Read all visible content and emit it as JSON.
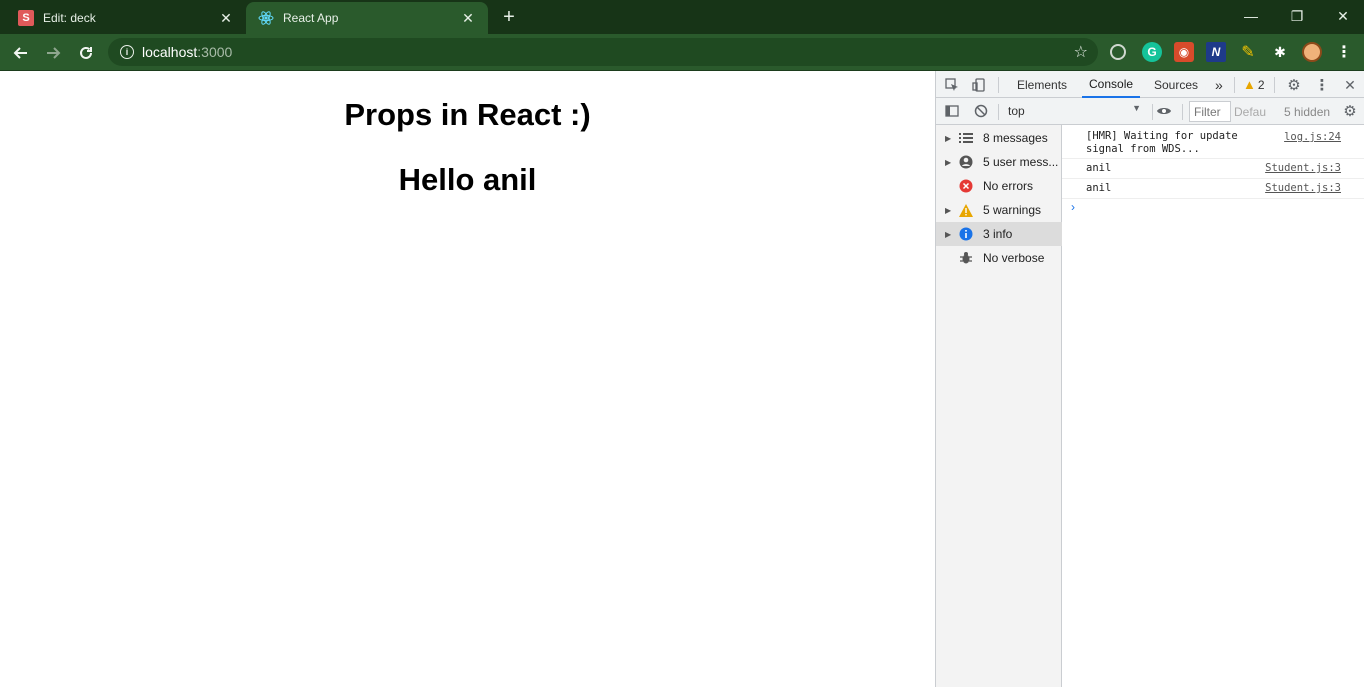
{
  "browser": {
    "tabs": [
      {
        "title": "Edit: deck",
        "favicon_letter": "S",
        "active": false
      },
      {
        "title": "React App",
        "favicon": "react-icon",
        "active": true
      }
    ],
    "new_tab_label": "+",
    "address": {
      "host": "localhost",
      "port": ":3000"
    },
    "window_controls": {
      "minimize": "—",
      "restore": "❐",
      "close": "✕"
    }
  },
  "page": {
    "heading": "Props in React :)",
    "greeting": "Hello anil"
  },
  "devtools": {
    "tabs": [
      "Elements",
      "Console",
      "Sources"
    ],
    "active_tab": "Console",
    "more_tabs": "»",
    "warning_count": "2",
    "filter_bar": {
      "context": "top",
      "filter_placeholder": "Filter",
      "levels": "Defau",
      "hidden": "5 hidden"
    },
    "sidebar": [
      {
        "label": "8 messages",
        "icon": "list-icon",
        "expandable": true
      },
      {
        "label": "5 user mess...",
        "icon": "user-icon",
        "expandable": true
      },
      {
        "label": "No errors",
        "icon": "error-icon",
        "expandable": false
      },
      {
        "label": "5 warnings",
        "icon": "warning-icon",
        "expandable": true
      },
      {
        "label": "3 info",
        "icon": "info-icon",
        "expandable": true,
        "selected": true
      },
      {
        "label": "No verbose",
        "icon": "bug-icon",
        "expandable": false
      }
    ],
    "console_logs": [
      {
        "message": "[HMR] Waiting for update\nsignal from WDS...",
        "source": "log.js:24"
      },
      {
        "message": "anil",
        "source": "Student.js:3"
      },
      {
        "message": "anil",
        "source": "Student.js:3"
      }
    ],
    "prompt": "›"
  },
  "colors": {
    "tabstrip": "#173417",
    "toolbar": "#2a5a2c",
    "devtools_accent": "#1a73e8",
    "warning": "#e8a600",
    "error": "#e53935",
    "info": "#1a73e8"
  }
}
